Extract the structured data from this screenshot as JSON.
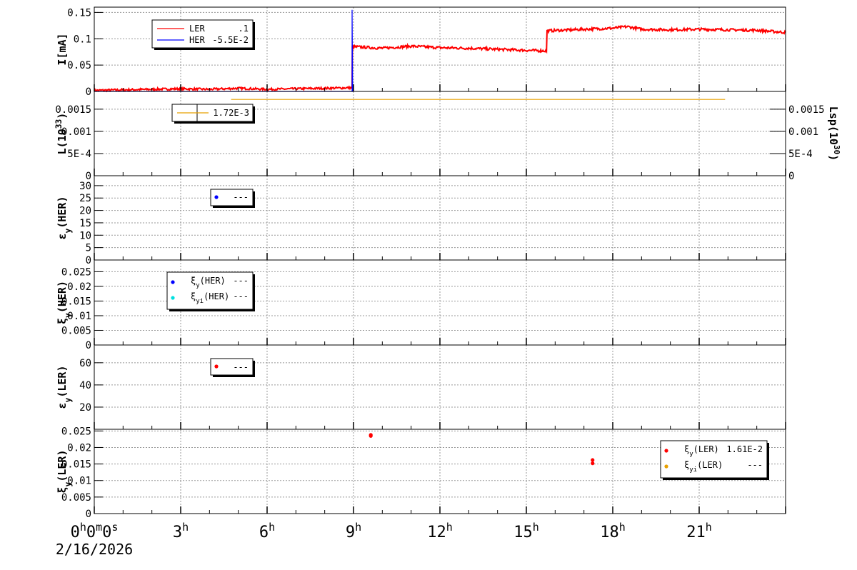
{
  "chart_data": [
    {
      "type": "line",
      "ylabel": "I[mA]",
      "ylim": [
        0,
        0.16
      ],
      "yticks": [
        0,
        0.05,
        0.1,
        0.15
      ],
      "ytick_labels": [
        "0",
        "0.05",
        "0.1",
        "0.15"
      ],
      "grid": true,
      "series": [
        {
          "name": "LER",
          "legend_value": ".1",
          "color": "#ff0000",
          "x": [
            0,
            1,
            2,
            3,
            4,
            5,
            6,
            7,
            8,
            8.95,
            8.96,
            10,
            11,
            12,
            13,
            14,
            15,
            15.7,
            15.72,
            17,
            18,
            18.5,
            19,
            20,
            21,
            22,
            23,
            24
          ],
          "y": [
            0.002,
            0.003,
            0.004,
            0.005,
            0.004,
            0.006,
            0.004,
            0.005,
            0.006,
            0.007,
            0.085,
            0.082,
            0.086,
            0.083,
            0.082,
            0.08,
            0.078,
            0.077,
            0.115,
            0.118,
            0.12,
            0.123,
            0.118,
            0.117,
            0.118,
            0.117,
            0.116,
            0.112
          ]
        },
        {
          "name": "HER",
          "legend_value": "-5.5E-2",
          "color": "#0000ff",
          "x": [
            0,
            8.9,
            8.95,
            8.95,
            8.97,
            9.0
          ],
          "y": [
            0.0,
            0.0,
            0.0,
            0.155,
            0.0,
            0.0
          ]
        }
      ]
    },
    {
      "type": "line",
      "ylabel": "L(10^33)",
      "y2label": "Lsp(10^30)",
      "ylim": [
        0,
        0.0019
      ],
      "yticks": [
        0,
        0.0005,
        0.001,
        0.0015
      ],
      "ytick_labels": [
        "0",
        "5E-4",
        "0.001",
        "0.0015"
      ],
      "grid": true,
      "series": [
        {
          "name": "",
          "legend_value": "1.72E-3",
          "color": "#e8a000",
          "x": [
            4.75,
            21.9
          ],
          "y": [
            0.00172,
            0.00172
          ]
        }
      ]
    },
    {
      "type": "scatter",
      "ylabel": "εy(HER)",
      "ylim": [
        0,
        34
      ],
      "yticks": [
        0,
        5,
        10,
        15,
        20,
        25,
        30
      ],
      "ytick_labels": [
        "0",
        "5",
        "10",
        "15",
        "20",
        "25",
        "30"
      ],
      "grid": true,
      "series": [
        {
          "name": "",
          "legend_value": "---",
          "color": "#0000ff",
          "x": [],
          "y": []
        }
      ]
    },
    {
      "type": "scatter",
      "ylabel": "ξy(HER)",
      "ylim": [
        0,
        0.029
      ],
      "yticks": [
        0,
        0.005,
        0.01,
        0.015,
        0.02,
        0.025
      ],
      "ytick_labels": [
        "0",
        "0.005",
        "0.01",
        "0.015",
        "0.02",
        "0.025"
      ],
      "grid": true,
      "series": [
        {
          "name": "ξy(HER)",
          "legend_value": "---",
          "color": "#0000ff",
          "x": [],
          "y": []
        },
        {
          "name": "ξyi(HER)",
          "legend_value": "---",
          "color": "#00e0e0",
          "x": [],
          "y": []
        }
      ]
    },
    {
      "type": "scatter",
      "ylabel": "εy(LER)",
      "ylim": [
        0,
        76
      ],
      "yticks": [
        20,
        40,
        60
      ],
      "ytick_labels": [
        "20",
        "40",
        "60"
      ],
      "grid": true,
      "series": [
        {
          "name": "",
          "legend_value": "---",
          "color": "#ff0000",
          "x": [],
          "y": []
        }
      ]
    },
    {
      "type": "scatter",
      "ylabel": "ξy(LER)",
      "ylim": [
        0,
        0.0255
      ],
      "yticks": [
        0,
        0.005,
        0.01,
        0.015,
        0.02,
        0.025
      ],
      "ytick_labels": [
        "0",
        "0.005",
        "0.01",
        "0.015",
        "0.02",
        "0.025"
      ],
      "grid": true,
      "series": [
        {
          "name": "ξy(LER)",
          "legend_value": "1.61E-2",
          "color": "#ff0000",
          "x": [
            9.6,
            9.6,
            17.3,
            17.3,
            22.0
          ],
          "y": [
            0.0238,
            0.0235,
            0.0162,
            0.0152,
            0.016
          ]
        },
        {
          "name": "ξyi(LER)",
          "legend_value": "---",
          "color": "#e8a000",
          "x": [],
          "y": []
        }
      ]
    }
  ],
  "x_axis": {
    "range_hours": [
      0,
      24
    ],
    "ticks": [
      0,
      3,
      6,
      9,
      12,
      15,
      18,
      21
    ],
    "tick_labels": [
      "0h0m0s",
      "3h",
      "6h",
      "9h",
      "12h",
      "15h",
      "18h",
      "21h"
    ],
    "date_label": "2/16/2026"
  },
  "colors": {
    "ler": "#ff0000",
    "her": "#0000ff",
    "lum": "#e8a000",
    "cyan": "#00e0e0"
  }
}
